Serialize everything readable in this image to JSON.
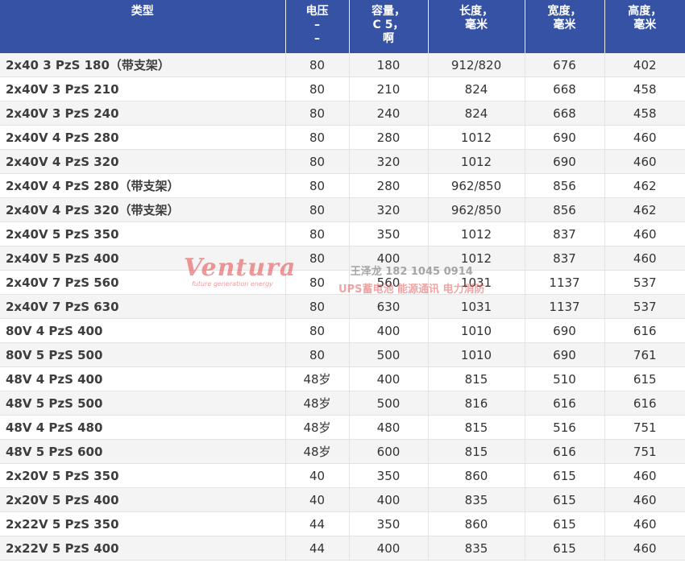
{
  "headers": [
    "类型",
    "电压\n–\n–",
    "容量，\nC 5，\n啊",
    "长度，\n毫米",
    "宽度，\n毫米",
    "高度，\n毫米"
  ],
  "rows": [
    [
      "2x40 3 PzS 180（带支架）",
      "80",
      "180",
      "912/820",
      "676",
      "402"
    ],
    [
      "2x40V 3 PzS 210",
      "80",
      "210",
      "824",
      "668",
      "458"
    ],
    [
      "2x40V 3 PzS 240",
      "80",
      "240",
      "824",
      "668",
      "458"
    ],
    [
      "2x40V 4 PzS 280",
      "80",
      "280",
      "1012",
      "690",
      "460"
    ],
    [
      "2x40V 4 PzS 320",
      "80",
      "320",
      "1012",
      "690",
      "460"
    ],
    [
      "2x40V 4 PzS 280（带支架）",
      "80",
      "280",
      "962/850",
      "856",
      "462"
    ],
    [
      "2x40V 4 PzS 320（带支架）",
      "80",
      "320",
      "962/850",
      "856",
      "462"
    ],
    [
      "2x40V 5 PzS 350",
      "80",
      "350",
      "1012",
      "837",
      "460"
    ],
    [
      "2x40V 5 PzS 400",
      "80",
      "400",
      "1012",
      "837",
      "460"
    ],
    [
      "2x40V 7 PzS 560",
      "80",
      "560",
      "1031",
      "1137",
      "537"
    ],
    [
      "2x40V 7 PzS 630",
      "80",
      "630",
      "1031",
      "1137",
      "537"
    ],
    [
      "80V 4 PzS 400",
      "80",
      "400",
      "1010",
      "690",
      "616"
    ],
    [
      "80V 5 PzS 500",
      "80",
      "500",
      "1010",
      "690",
      "761"
    ],
    [
      "48V 4 PzS 400",
      "48岁",
      "400",
      "815",
      "510",
      "615"
    ],
    [
      "48V 5 PzS 500",
      "48岁",
      "500",
      "816",
      "616",
      "616"
    ],
    [
      "48V 4 PzS 480",
      "48岁",
      "480",
      "815",
      "516",
      "751"
    ],
    [
      "48V 5 PzS 600",
      "48岁",
      "600",
      "815",
      "616",
      "751"
    ],
    [
      "2x20V 5 PzS 350",
      "40",
      "350",
      "860",
      "615",
      "460"
    ],
    [
      "2x20V 5 PzS 400",
      "40",
      "400",
      "835",
      "615",
      "460"
    ],
    [
      "2x22V 5 PzS 350",
      "44",
      "350",
      "860",
      "615",
      "460"
    ],
    [
      "2x22V 5 PzS 400",
      "44",
      "400",
      "835",
      "615",
      "460"
    ]
  ],
  "watermark": {
    "brand": "Ventura",
    "tagline": "future generation energy",
    "contact_line1": "王泽龙 182 1045 0914",
    "contact_line2": "UPS蓄电池 能源通讯 电力消防"
  },
  "colors": {
    "header_bg": "#3552a5",
    "row_alt": "#f4f4f4",
    "watermark": "#e24648"
  }
}
